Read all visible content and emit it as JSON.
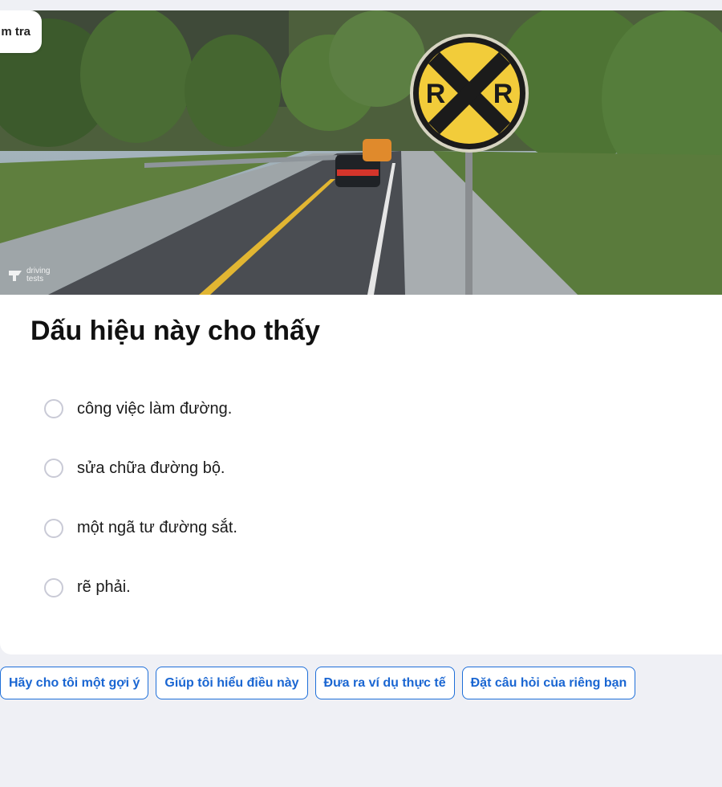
{
  "badge": {
    "label": "m tra"
  },
  "image": {
    "sign": {
      "left_letter": "R",
      "right_letter": "R"
    },
    "watermark": {
      "line1": "driving",
      "line2": "tests"
    }
  },
  "question": {
    "title": "Dấu hiệu này cho thấy"
  },
  "options": [
    {
      "label": "công việc làm đường."
    },
    {
      "label": "sửa chữa đường bộ."
    },
    {
      "label": "một ngã tư đường sắt."
    },
    {
      "label": "rẽ phải."
    }
  ],
  "chips": [
    {
      "label": "Hãy cho tôi một gợi ý"
    },
    {
      "label": "Giúp tôi hiểu điều này"
    },
    {
      "label": "Đưa ra ví dụ thực tế"
    },
    {
      "label": "Đặt câu hỏi của riêng bạn"
    }
  ],
  "colors": {
    "accent": "#1e6fd9",
    "sign_yellow": "#f2cc3a",
    "background": "#eff0f5"
  }
}
